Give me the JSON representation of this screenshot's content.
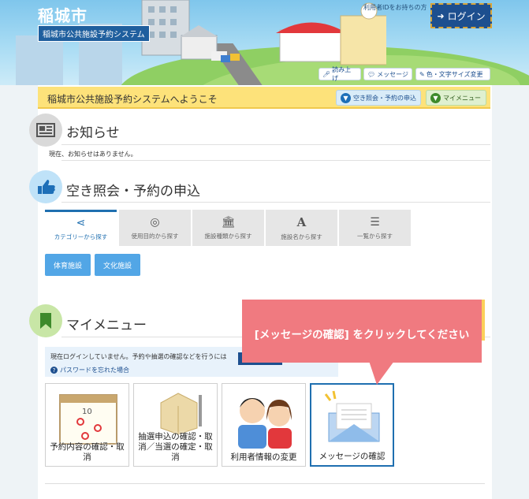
{
  "header": {
    "title": "稲城市",
    "subtitle": "稲城市公共施設予約システム",
    "login_hint": "利用者IDをお持ちの方",
    "login_label": "ログイン",
    "utilities": [
      "読み上げ",
      "メッセージ",
      "色・文字サイズ変更"
    ]
  },
  "welcome": {
    "text": "稲城市公共施設予約システムへようこそ",
    "buttons": [
      "空き照会・予約の申込",
      "マイメニュー"
    ]
  },
  "news": {
    "title": "お知らせ",
    "message": "現在、お知らせはありません。"
  },
  "reserve": {
    "title": "空き照会・予約の申込",
    "tabs": [
      "カテゴリーから探す",
      "使用目的から探す",
      "施設種類から探す",
      "施設名から探す",
      "一覧から探す"
    ],
    "categories": [
      "体育施設",
      "文化施設"
    ]
  },
  "mymenu": {
    "title": "マイメニュー",
    "login_notice": "現在ログインしていません。予約や抽選の確認などを行うには",
    "forgot_password": "パスワードを忘れた場合",
    "cards": [
      "予約内容の確認・取消",
      "抽選申込の確認・取消／当選の確定・取消",
      "利用者情報の変更",
      "メッセージの確認"
    ]
  },
  "callout": {
    "text": "[メッセージの確認] をクリックしてください"
  },
  "colors": {
    "accent": "#1d4f8f",
    "welcome_bar": "#fde27a",
    "callout": "#f07a80"
  }
}
